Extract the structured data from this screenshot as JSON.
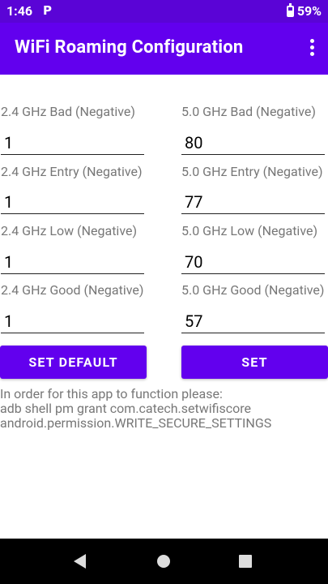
{
  "status_bar": {
    "time": "1:46",
    "notification_glyph": "P",
    "battery": "59%"
  },
  "app_bar": {
    "title": "WiFi Roaming Configuration"
  },
  "fields_24": [
    {
      "label": "2.4 GHz Bad (Negative)",
      "value": "1"
    },
    {
      "label": "2.4 GHz Entry (Negative)",
      "value": "1"
    },
    {
      "label": "2.4 GHz Low (Negative)",
      "value": "1"
    },
    {
      "label": "2.4 GHz Good (Negative)",
      "value": "1"
    }
  ],
  "fields_50": [
    {
      "label": "5.0 GHz Bad (Negative)",
      "value": "80"
    },
    {
      "label": "5.0 GHz Entry (Negative)",
      "value": "77"
    },
    {
      "label": "5.0 GHz Low (Negative)",
      "value": "70"
    },
    {
      "label": "5.0 GHz Good (Negative)",
      "value": "57"
    }
  ],
  "buttons": {
    "set_default": "SET DEFAULT",
    "set": "SET"
  },
  "info": {
    "line1": "In order for this app to function please:",
    "line2": "adb shell pm grant com.catech.setwifiscore",
    "line3": "android.permission.WRITE_SECURE_SETTINGS"
  },
  "colors": {
    "status_bar": "#5a04d6",
    "app_bar": "#6200ee",
    "accent": "#6200ee"
  }
}
